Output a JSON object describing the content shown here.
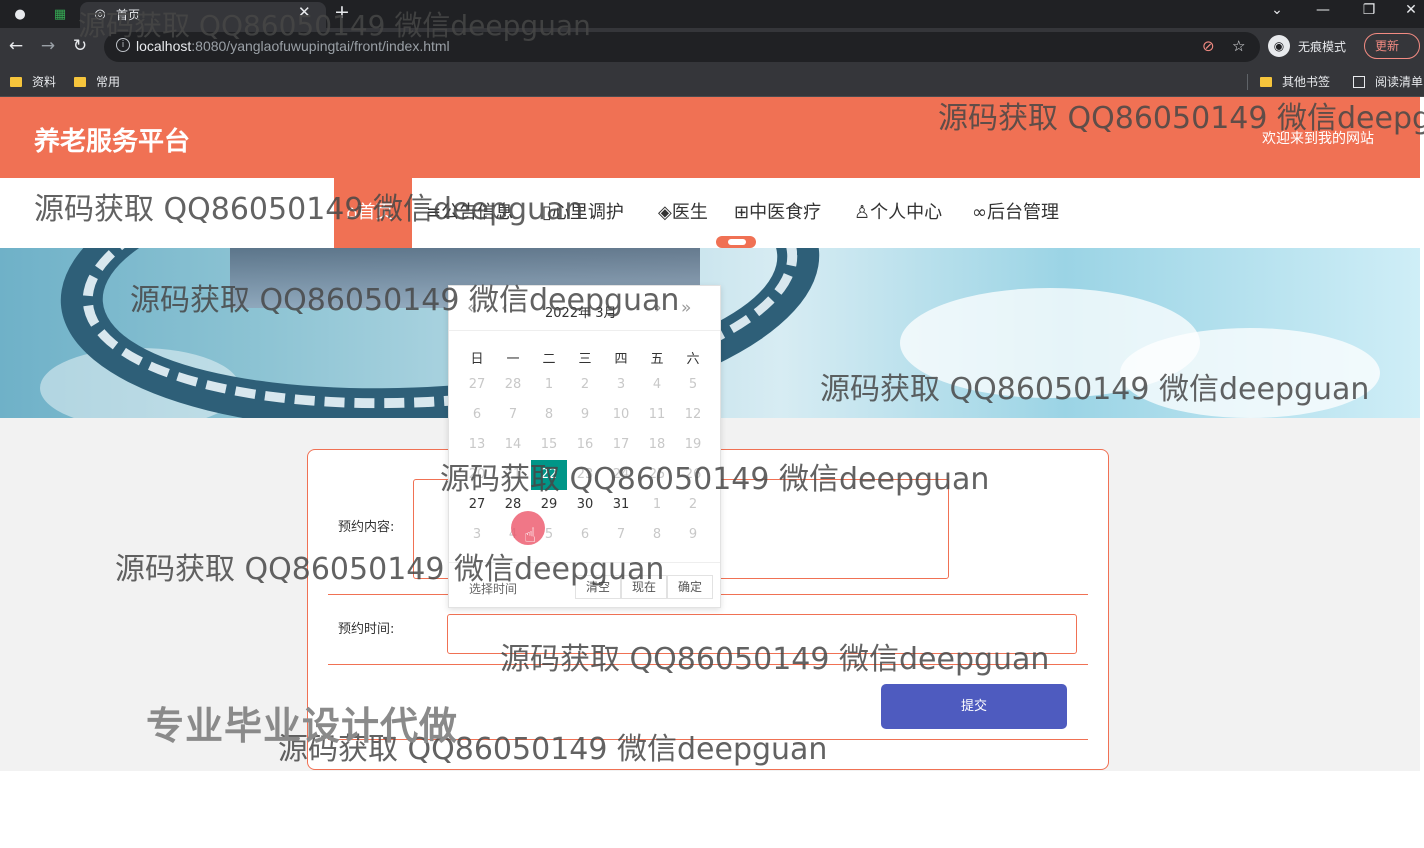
{
  "browser": {
    "tab_title": "首页",
    "url_host": "localhost",
    "url_rest": ":8080/yanglaofuwupingtai/front/index.html",
    "incognito_label": "无痕模式",
    "update_label": "更新",
    "bookmarks": [
      "资料",
      "常用"
    ],
    "bookmarks_right": [
      "其他书签",
      "阅读清单"
    ]
  },
  "site": {
    "title": "养老服务平台",
    "welcome": "欢迎来到我的网站",
    "nav": [
      {
        "icon": "home-icon",
        "glyph": "⌂",
        "label": "首页"
      },
      {
        "icon": "list-icon",
        "glyph": "≡",
        "label": "公告信息"
      },
      {
        "icon": "book-icon",
        "glyph": "▯",
        "label": "心里调护"
      },
      {
        "icon": "layers-icon",
        "glyph": "◈",
        "label": "医生"
      },
      {
        "icon": "grid-icon",
        "glyph": "⊞",
        "label": "中医食疗"
      },
      {
        "icon": "user-icon",
        "glyph": "♙",
        "label": "个人中心"
      },
      {
        "icon": "link-icon",
        "glyph": "∞",
        "label": "后台管理"
      }
    ]
  },
  "form": {
    "content_label": "预约内容:",
    "time_label": "预约时间:",
    "submit_label": "提交"
  },
  "datepicker": {
    "year_month": "2022年  3月",
    "weekdays": [
      "日",
      "一",
      "二",
      "三",
      "四",
      "五",
      "六"
    ],
    "days": [
      {
        "d": "27",
        "other": true
      },
      {
        "d": "28",
        "other": true
      },
      {
        "d": "1",
        "other": true
      },
      {
        "d": "2",
        "other": true
      },
      {
        "d": "3",
        "other": true
      },
      {
        "d": "4",
        "other": true
      },
      {
        "d": "5",
        "other": true
      },
      {
        "d": "6",
        "other": true
      },
      {
        "d": "7",
        "other": true
      },
      {
        "d": "8",
        "other": true
      },
      {
        "d": "9",
        "other": true
      },
      {
        "d": "10",
        "other": true
      },
      {
        "d": "11",
        "other": true
      },
      {
        "d": "12",
        "other": true
      },
      {
        "d": "13",
        "other": true
      },
      {
        "d": "14",
        "other": true
      },
      {
        "d": "15",
        "other": true
      },
      {
        "d": "16",
        "other": true
      },
      {
        "d": "17",
        "other": true
      },
      {
        "d": "18",
        "other": true
      },
      {
        "d": "19",
        "other": true
      },
      {
        "d": "20",
        "other": true
      },
      {
        "d": "21",
        "other": true
      },
      {
        "d": "22",
        "selected": true
      },
      {
        "d": "23",
        "other": true
      },
      {
        "d": "24",
        "other": true
      },
      {
        "d": "25",
        "other": true
      },
      {
        "d": "26",
        "other": true
      },
      {
        "d": "27"
      },
      {
        "d": "28"
      },
      {
        "d": "29"
      },
      {
        "d": "30"
      },
      {
        "d": "31"
      },
      {
        "d": "1",
        "other": true
      },
      {
        "d": "2",
        "other": true
      },
      {
        "d": "3",
        "other": true
      },
      {
        "d": "4",
        "other": true
      },
      {
        "d": "5",
        "other": true
      },
      {
        "d": "6",
        "other": true
      },
      {
        "d": "7",
        "other": true
      },
      {
        "d": "8",
        "other": true
      },
      {
        "d": "9",
        "other": true
      }
    ],
    "footer_label": "选择时间",
    "buttons": [
      "清空",
      "现在",
      "确定"
    ],
    "selected_color": "#009688"
  },
  "watermarks": {
    "text": "源码获取 QQ86050149 微信deepguan",
    "banner_text": "专业毕业设计代做"
  },
  "colors": {
    "accent": "#f07154",
    "submit": "#4e5bbf"
  }
}
